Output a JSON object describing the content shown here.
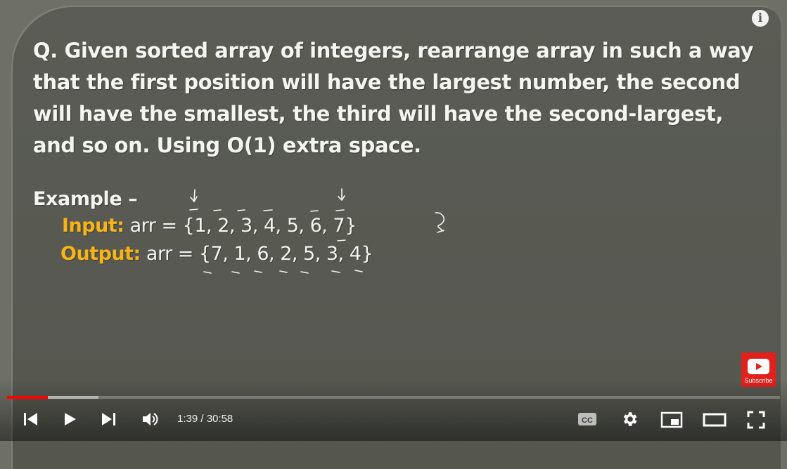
{
  "player": {
    "progress_played_fraction": 0.053,
    "progress_buffered_fraction": 0.118,
    "time_current": "1:39",
    "time_separator": " / ",
    "time_total": "30:58",
    "icons": [
      "info-icon",
      "previous-icon",
      "play-icon",
      "next-icon",
      "volume-icon",
      "captions-icon",
      "settings-icon",
      "miniplayer-icon",
      "theater-icon",
      "fullscreen-icon"
    ],
    "accent_color": "#ff0000"
  },
  "subscribe": {
    "label": "Subscribe",
    "color": "#e1211c"
  },
  "slide": {
    "question_lines": [
      "Q. Given sorted array of integers, rearrange array in such a way",
      "that the first position will have the largest number, the second",
      "will have the smallest, the third will have the second-largest,",
      "and so on. Using O(1) extra space."
    ],
    "example_label": "Example –",
    "input_keyword": "Input:",
    "input_value": " arr = {1, 2, 3, 4, 5, 6, 7}",
    "output_keyword": "Output:",
    "output_value": " arr = {7, 1, 6, 2, 5, 3, 4}",
    "keyword_color": "#f7b417",
    "text_color": "#f4f4f0"
  }
}
